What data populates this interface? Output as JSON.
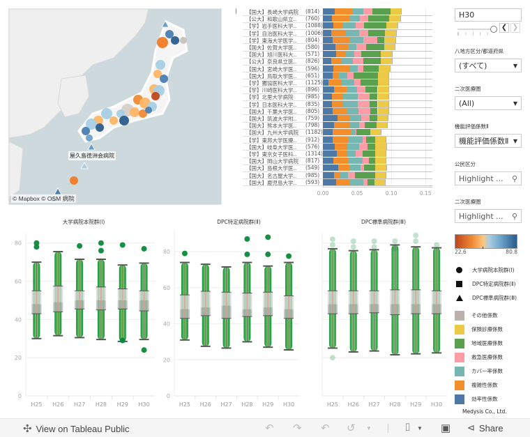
{
  "map": {
    "attribution": "© Mapbox  © OSM 病院",
    "label": "屋久島徳洲会病院"
  },
  "ranking": {
    "x_ticks": [
      "0.00",
      "0.05",
      "0.10",
      "0.15"
    ],
    "x_max": 0.16,
    "segment_order": [
      "効率性係数",
      "複雑性係数",
      "カバー率係数",
      "救急医療係数",
      "地域医療係数",
      "保険診療係数",
      "その他係数"
    ],
    "rows": [
      {
        "name": "【国大】長崎大学病院",
        "count": "(814)",
        "values": [
          0.0175,
          0.026,
          0.016,
          0.013,
          0.026,
          0.016,
          0.001
        ]
      },
      {
        "name": "【公大】和歌山県立..",
        "count": "(760)",
        "values": [
          0.013,
          0.026,
          0.015,
          0.012,
          0.031,
          0.016,
          0.001
        ]
      },
      {
        "name": "【学】岩手医科大学..",
        "count": "(1088)",
        "values": [
          0.015,
          0.015,
          0.018,
          0.012,
          0.033,
          0.016,
          0.001
        ]
      },
      {
        "name": "【学】自治医科大学..",
        "count": "(1006)",
        "values": [
          0.012,
          0.022,
          0.019,
          0.013,
          0.025,
          0.016,
          0.001
        ]
      },
      {
        "name": "【学】東海大学医学..",
        "count": "(804)",
        "values": [
          0.014,
          0.026,
          0.019,
          0.02,
          0.011,
          0.016,
          0.001
        ]
      },
      {
        "name": "【国大】佐賀大学医..",
        "count": "(580)",
        "values": [
          0.018,
          0.019,
          0.012,
          0.014,
          0.027,
          0.015,
          0.001
        ]
      },
      {
        "name": "【国大】旭川医科大..",
        "count": "(571)",
        "values": [
          0.019,
          0.014,
          0.013,
          0.01,
          0.029,
          0.016,
          0.001
        ]
      },
      {
        "name": "【公大】奈良県立医..",
        "count": "(826)",
        "values": [
          0.012,
          0.016,
          0.016,
          0.015,
          0.026,
          0.016,
          0.001
        ]
      },
      {
        "name": "【国大】宮崎大学医..",
        "count": "(596)",
        "values": [
          0.015,
          0.025,
          0.011,
          0.008,
          0.023,
          0.016,
          0.001
        ]
      },
      {
        "name": "【国大】鳥取大学医..",
        "count": "(651)",
        "values": [
          0.014,
          0.009,
          0.013,
          0.009,
          0.035,
          0.016,
          0.001
        ]
      },
      {
        "name": "【学】獨協医科大学..",
        "count": "(1125)",
        "values": [
          0.008,
          0.018,
          0.02,
          0.009,
          0.026,
          0.015,
          0.001
        ]
      },
      {
        "name": "【学】川崎医科大学..",
        "count": "(896)",
        "values": [
          0.016,
          0.019,
          0.015,
          0.012,
          0.018,
          0.016,
          0.001
        ]
      },
      {
        "name": "【学】北里大学病院",
        "count": "(985)",
        "values": [
          0.013,
          0.017,
          0.021,
          0.017,
          0.012,
          0.016,
          0.001
        ]
      },
      {
        "name": "【学】日本医科大学..",
        "count": "(835)",
        "values": [
          0.013,
          0.017,
          0.021,
          0.017,
          0.012,
          0.016,
          0.001
        ]
      },
      {
        "name": "【国大】千葉大学医..",
        "count": "(805)",
        "values": [
          0.014,
          0.021,
          0.017,
          0.017,
          0.011,
          0.016,
          0.001
        ]
      },
      {
        "name": "【国大】筑波大学附..",
        "count": "(759)",
        "values": [
          0.021,
          0.019,
          0.016,
          0.012,
          0.011,
          0.016,
          0.001
        ]
      },
      {
        "name": "【国大】熊本大学医..",
        "count": "(798)",
        "values": [
          0.016,
          0.023,
          0.014,
          0.008,
          0.017,
          0.016,
          0.001
        ]
      },
      {
        "name": "【国大】九州大学病院",
        "count": "(1182)",
        "values": [
          0.014,
          0.027,
          0.007,
          0.001,
          0.02,
          0.016,
          0.001
        ]
      },
      {
        "name": "【学】東邦大学医療..",
        "count": "(912)",
        "values": [
          0.014,
          0.023,
          0.021,
          0.005,
          0.013,
          0.016,
          0.001
        ]
      },
      {
        "name": "【国大】岐阜大学医..",
        "count": "(576)",
        "values": [
          0.017,
          0.018,
          0.018,
          0.012,
          0.011,
          0.017,
          0.001
        ]
      },
      {
        "name": "【学】東京女子医科..",
        "count": "(1314)",
        "values": [
          0.02,
          0.015,
          0.013,
          0.01,
          0.018,
          0.016,
          0.001
        ]
      },
      {
        "name": "【国大】岡山大学病院",
        "count": "(817)",
        "values": [
          0.015,
          0.023,
          0.02,
          0.009,
          0.009,
          0.016,
          0.001
        ]
      },
      {
        "name": "【国大】島根大学医..",
        "count": "(549)",
        "values": [
          0.022,
          0.017,
          0.016,
          0.005,
          0.016,
          0.017,
          0.001
        ]
      },
      {
        "name": "【国大】名古屋大学..",
        "count": "(985)",
        "values": [
          0.016,
          0.009,
          0.012,
          0.01,
          0.029,
          0.016,
          0.001
        ]
      },
      {
        "name": "【国大】鹿児島大学..",
        "count": "(593)",
        "values": [
          0.019,
          0.02,
          0.02,
          0.006,
          0.01,
          0.016,
          0.001
        ]
      }
    ]
  },
  "controls": {
    "year_value": "H30",
    "slider_position": 1.0,
    "region_title": "八地方区分/都道府県",
    "region_value": "(すべて)",
    "secondary_area_title": "二次医療圏",
    "secondary_area_value": "(All)",
    "coef_title": "機能評価係数Ⅱ",
    "coef_value": "機能評価係数Ⅱ",
    "public_private_title": "公民区分",
    "public_private_placeholder": "Highlight ...",
    "secondary_area2_title": "二次医療圏",
    "secondary_area2_placeholder": "Highlight ...",
    "color_min": "22.6",
    "color_max": "80.8"
  },
  "shape_legend": [
    {
      "shape": "circle",
      "label": "大学病院本院群(Ⅰ)"
    },
    {
      "shape": "square",
      "label": "DPC特定病院群(Ⅱ)"
    },
    {
      "shape": "triangle",
      "label": "DPC標準病院群(Ⅲ)"
    }
  ],
  "color_legend": [
    {
      "label": "その他係数",
      "color": "#bab0ac"
    },
    {
      "label": "保険診療係数",
      "color": "#edc948"
    },
    {
      "label": "地域医療係数",
      "color": "#59a14f"
    },
    {
      "label": "救急医療係数",
      "color": "#ff9da7"
    },
    {
      "label": "カバー率係数",
      "color": "#76b7b2"
    },
    {
      "label": "複雑性係数",
      "color": "#f28e2b"
    },
    {
      "label": "効率性係数",
      "color": "#4e79a7"
    }
  ],
  "segment_colors": [
    "#4e79a7",
    "#f28e2b",
    "#76b7b2",
    "#ff9da7",
    "#59a14f",
    "#edc948",
    "#bab0ac"
  ],
  "credit": "Medysis Co., Ltd.",
  "chart_data": [
    {
      "type": "box",
      "title": "大学病院本院群(Ⅰ)",
      "categories": [
        "H25",
        "H26",
        "H27",
        "H28",
        "H29",
        "H30"
      ],
      "ylim": [
        0,
        85
      ],
      "yticks": [
        0,
        20,
        40,
        60,
        80
      ],
      "boxes": [
        {
          "low": 30,
          "q1": 43,
          "median": 48,
          "q3": 55,
          "high": 70,
          "outliers": [
            80,
            78
          ]
        },
        {
          "low": 31.5,
          "q1": 44,
          "median": 49,
          "q3": 57.5,
          "high": 75.5,
          "outliers": []
        },
        {
          "low": 30.5,
          "q1": 45.5,
          "median": 50,
          "q3": 55,
          "high": 71.5,
          "outliers": [
            78.5
          ]
        },
        {
          "low": 29.5,
          "q1": 45,
          "median": 50,
          "q3": 57,
          "high": 71.5,
          "outliers": [
            80,
            76
          ]
        },
        {
          "low": 28.5,
          "q1": 45.5,
          "median": 50,
          "q3": 56,
          "high": 68.5,
          "outliers": [
            79,
            29
          ]
        },
        {
          "low": 29.5,
          "q1": 44.5,
          "median": 50,
          "q3": 55,
          "high": 69.5,
          "outliers": [
            77,
            24
          ]
        }
      ]
    },
    {
      "type": "box",
      "title": "DPC特定病院群(Ⅱ)",
      "categories": [
        "H25",
        "H26",
        "H27",
        "H28",
        "H29",
        "H30"
      ],
      "ylim": [
        0,
        92
      ],
      "yticks": [
        0,
        20,
        40,
        60,
        80
      ],
      "boxes": [
        {
          "low": 31,
          "q1": 43,
          "median": 48,
          "q3": 56,
          "high": 74,
          "outliers": [
            79
          ]
        },
        {
          "low": 27.5,
          "q1": 44.5,
          "median": 49,
          "q3": 58,
          "high": 73,
          "outliers": []
        },
        {
          "low": 26.5,
          "q1": 43,
          "median": 50,
          "q3": 57.5,
          "high": 71.5,
          "outliers": []
        },
        {
          "low": 30,
          "q1": 44,
          "median": 48,
          "q3": 57,
          "high": 74,
          "outliers": [
            87,
            78.5
          ]
        },
        {
          "low": 27,
          "q1": 44.5,
          "median": 49,
          "q3": 57.5,
          "high": 72,
          "outliers": [
            88,
            78.5
          ]
        },
        {
          "low": 25.5,
          "q1": 43,
          "median": 48,
          "q3": 55.5,
          "high": 74,
          "outliers": [
            77.5
          ]
        }
      ]
    },
    {
      "type": "box",
      "title": "DPC標準病院群(Ⅲ)",
      "categories": [
        "H25",
        "H26",
        "H27",
        "H28",
        "H29",
        "H30"
      ],
      "ylim": [
        0,
        85
      ],
      "yticks": [
        0,
        20,
        40,
        60,
        80
      ],
      "boxes": [
        {
          "low": 25,
          "q1": 43,
          "median": 48,
          "q3": 55,
          "high": 77,
          "outliers": [
            82,
            79,
            20
          ]
        },
        {
          "low": 23,
          "q1": 43,
          "median": 48,
          "q3": 55,
          "high": 76,
          "outliers": [
            81,
            78
          ]
        },
        {
          "low": 23.5,
          "q1": 43.5,
          "median": 48,
          "q3": 55,
          "high": 76.5,
          "outliers": [
            81,
            78
          ]
        },
        {
          "low": 21.5,
          "q1": 42.5,
          "median": 48,
          "q3": 55.5,
          "high": 79,
          "outliers": [
            81,
            77
          ]
        },
        {
          "low": 22,
          "q1": 43,
          "median": 48,
          "q3": 55.5,
          "high": 78,
          "outliers": [
            84,
            81
          ]
        },
        {
          "low": 22.5,
          "q1": 43,
          "median": 48,
          "q3": 55,
          "high": 77.5,
          "outliers": [
            79
          ]
        }
      ]
    }
  ],
  "footer": {
    "view_on_tableau": "View on Tableau Public",
    "share": "Share"
  }
}
